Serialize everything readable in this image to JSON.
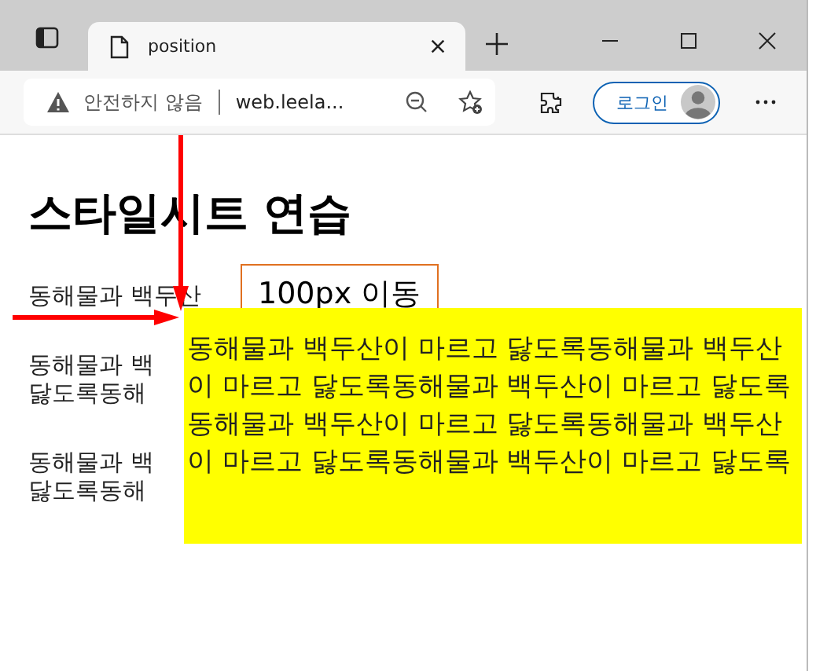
{
  "browser": {
    "tabs": [
      {
        "title": "position",
        "selected": true
      }
    ],
    "security": "안전하지 않음",
    "url": "web.leela...",
    "profile_button": "로그인"
  },
  "page": {
    "heading": "스타일시트 연습",
    "paragraphs": [
      [
        "동해물과 백두산"
      ],
      [
        "동해물과 백",
        "닳도록동해"
      ],
      [
        "동해물과 백",
        "닳도록동해"
      ]
    ],
    "moved_label": "100px 이동",
    "yellow_box": "동해물과 백두산이 마르고 닳도록동해물과 백두산이 마르고 닳도록동해물과 백두산이 마르고 닳도록동해물과 백두산이 마르고 닳도록동해물과 백두산이 마르고 닳도록동해물과 백두산이 마르고 닳도록"
  }
}
